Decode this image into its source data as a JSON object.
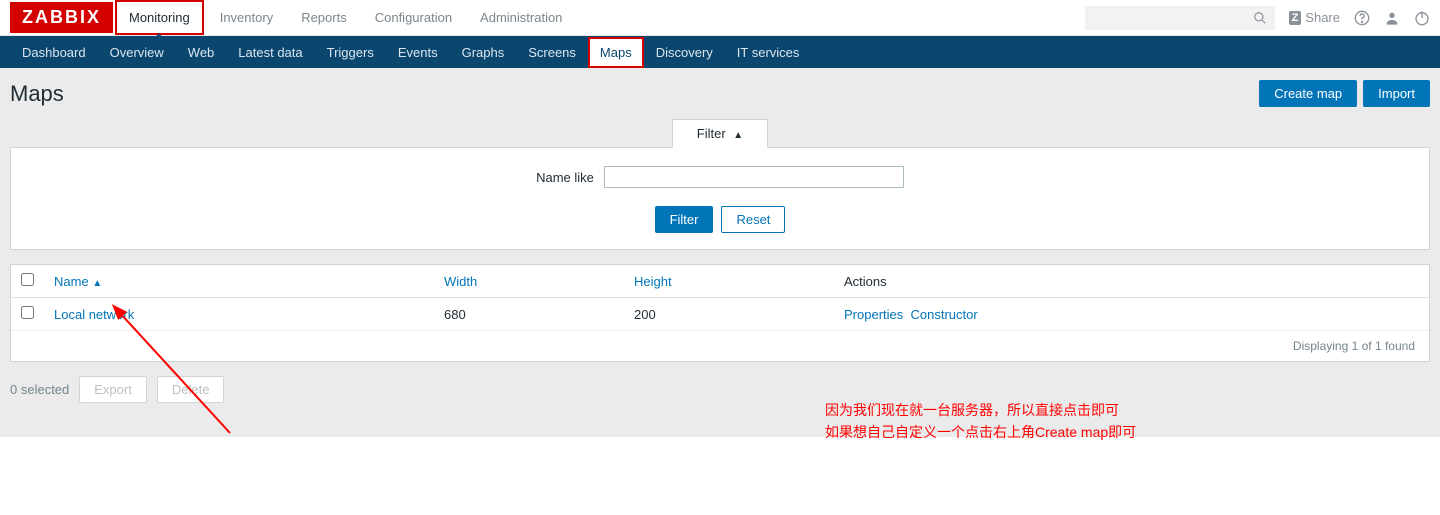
{
  "logo": "ZABBIX",
  "topnav": [
    "Monitoring",
    "Inventory",
    "Reports",
    "Configuration",
    "Administration"
  ],
  "topnav_active": "Monitoring",
  "share_label": "Share",
  "subnav": [
    "Dashboard",
    "Overview",
    "Web",
    "Latest data",
    "Triggers",
    "Events",
    "Graphs",
    "Screens",
    "Maps",
    "Discovery",
    "IT services"
  ],
  "subnav_active": "Maps",
  "page_title": "Maps",
  "buttons": {
    "create": "Create map",
    "import": "Import",
    "filter": "Filter",
    "reset": "Reset",
    "export": "Export",
    "delete": "Delete"
  },
  "filter_tab": "Filter",
  "filter_label": "Name like",
  "table": {
    "headers": {
      "name": "Name",
      "width": "Width",
      "height": "Height",
      "actions": "Actions"
    },
    "rows": [
      {
        "name": "Local network",
        "width": "680",
        "height": "200",
        "action1": "Properties",
        "action2": "Constructor"
      }
    ],
    "footer": "Displaying 1 of 1 found"
  },
  "selected_text": "0 selected",
  "annotation": {
    "line1": "因为我们现在就一台服务器，所以直接点击即可",
    "line2": "如果想自己自定义一个点击右上角Create map即可"
  }
}
